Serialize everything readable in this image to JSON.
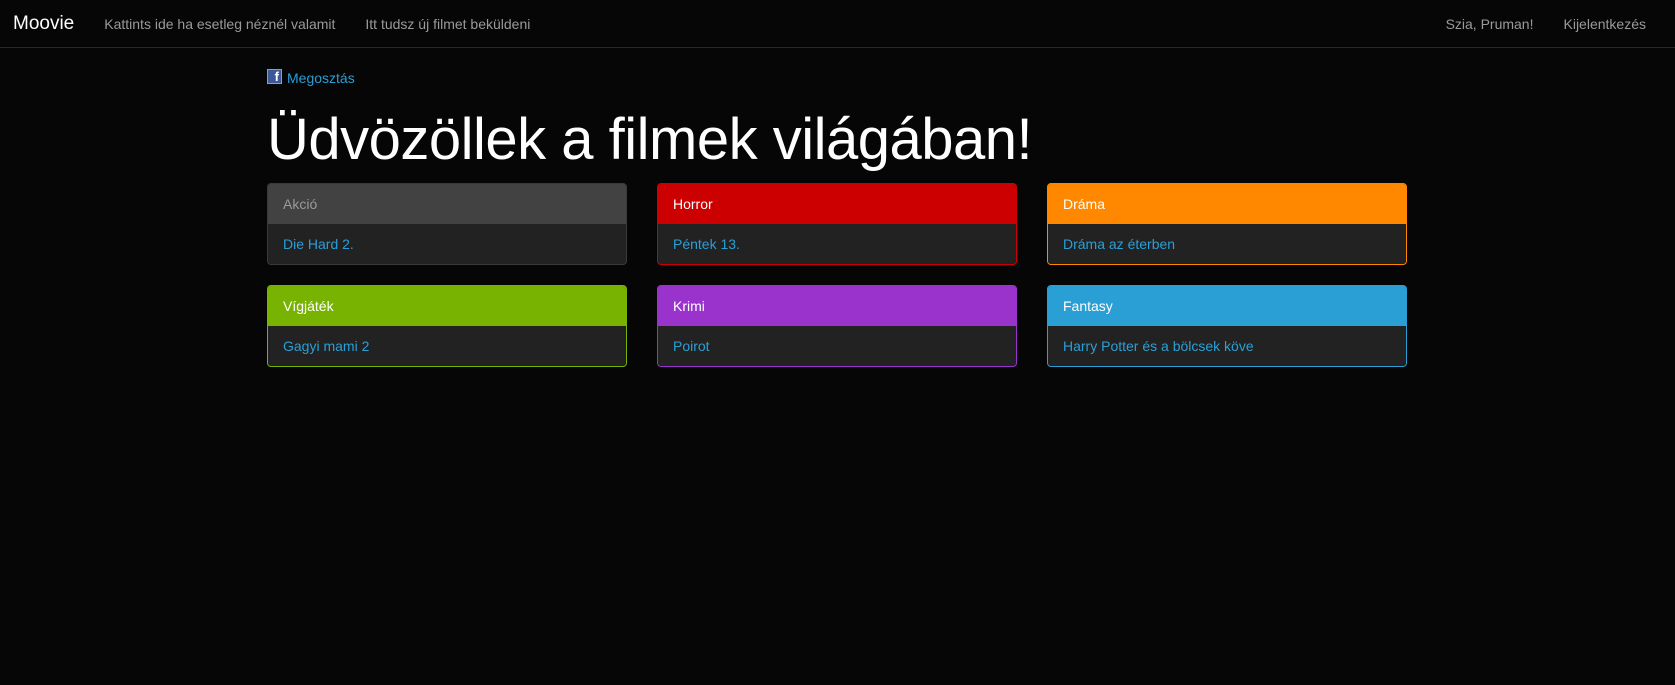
{
  "navbar": {
    "brand": "Moovie",
    "links": [
      "Kattints ide ha esetleg néznél valamit",
      "Itt tudsz új filmet beküldeni"
    ],
    "greeting": "Szia, Pruman!",
    "logout": "Kijelentkezés"
  },
  "share": {
    "icon": "facebook-icon",
    "glyph": "f",
    "label": "Megosztás"
  },
  "page_title": "Üdvözöllek a filmek világában!",
  "categories": [
    {
      "name": "Akció",
      "movie": "Die Hard 2.",
      "color": "#424242"
    },
    {
      "name": "Horror",
      "movie": "Péntek 13.",
      "color": "#cc0000"
    },
    {
      "name": "Dráma",
      "movie": "Dráma az éterben",
      "color": "#ff8800"
    },
    {
      "name": "Vígjáték",
      "movie": "Gagyi mami 2",
      "color": "#77b300"
    },
    {
      "name": "Krimi",
      "movie": "Poirot",
      "color": "#9933cc"
    },
    {
      "name": "Fantasy",
      "movie": "Harry Potter és a bölcsek köve",
      "color": "#2a9fd6"
    }
  ]
}
